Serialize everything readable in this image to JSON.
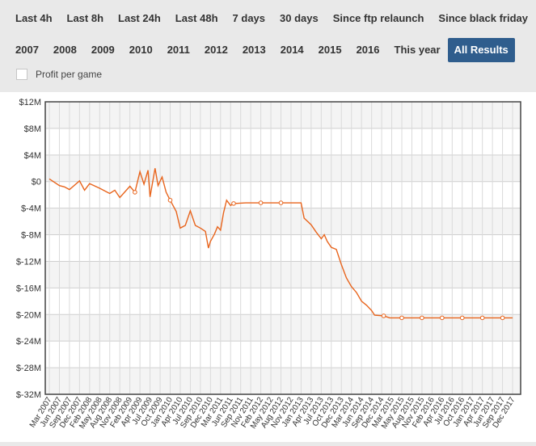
{
  "filters": {
    "row1": [
      "Last 4h",
      "Last 8h",
      "Last 24h",
      "Last 48h",
      "7 days",
      "30 days",
      "Since ftp relaunch",
      "Since black friday"
    ],
    "row2": [
      "2007",
      "2008",
      "2009",
      "2010",
      "2011",
      "2012",
      "2013",
      "2014",
      "2015",
      "2016",
      "This year",
      "All Results"
    ],
    "active": "All Results"
  },
  "checkbox": {
    "label": "Profit per game",
    "checked": false
  },
  "chart_data": {
    "type": "line",
    "title": "",
    "xlabel": "",
    "ylabel": "",
    "ylim": [
      -32,
      12
    ],
    "y_ticks": [
      12,
      8,
      4,
      0,
      -4,
      -8,
      -12,
      -16,
      -20,
      -24,
      -28,
      -32
    ],
    "y_tick_labels": [
      "$12M",
      "$8M",
      "$4M",
      "$0",
      "$-4M",
      "$-8M",
      "$-12M",
      "$-16M",
      "$-20M",
      "$-24M",
      "$-28M",
      "$-32M"
    ],
    "x_tick_labels": [
      "Mar 2007",
      "Jun 2007",
      "Sep 2007",
      "Dec 2007",
      "Feb 2008",
      "May 2008",
      "Aug 2008",
      "Nov 2008",
      "Feb 2009",
      "Apr 2009",
      "Jul 2009",
      "Oct 2009",
      "Jan 2010",
      "Apr 2010",
      "Jul 2010",
      "Sep 2010",
      "Dec 2010",
      "Mar 2011",
      "Jun 2011",
      "Sep 2011",
      "Nov 2011",
      "Feb 2012",
      "May 2012",
      "Aug 2012",
      "Nov 2012",
      "Jan 2013",
      "Apr 2013",
      "Jul 2013",
      "Oct 2013",
      "Dec 2013",
      "Mar 2014",
      "Jun 2014",
      "Sep 2014",
      "Dec 2014",
      "Mar 2015",
      "May 2015",
      "Aug 2015",
      "Nov 2015",
      "Feb 2016",
      "Apr 2016",
      "Jul 2016",
      "Oct 2016",
      "Jan 2017",
      "Apr 2017",
      "Jun 2017",
      "Sep 2017",
      "Dec 2017"
    ],
    "grid": true,
    "line_color": "#e8641c",
    "series": [
      {
        "values": [
          [
            0,
            0.4
          ],
          [
            1,
            -0.6
          ],
          [
            1.5,
            -0.8
          ],
          [
            2,
            -1.2
          ],
          [
            3,
            0.1
          ],
          [
            3.5,
            -1.3
          ],
          [
            4,
            -0.3
          ],
          [
            5,
            -1.0
          ],
          [
            6,
            -1.8
          ],
          [
            6.5,
            -1.3
          ],
          [
            7,
            -2.4
          ],
          [
            8,
            -0.7
          ],
          [
            8.5,
            -1.6
          ],
          [
            9,
            1.5
          ],
          [
            9.4,
            -0.4
          ],
          [
            9.8,
            1.7
          ],
          [
            10,
            -2.3
          ],
          [
            10.5,
            2.0
          ],
          [
            10.8,
            -0.6
          ],
          [
            11.2,
            0.7
          ],
          [
            11.6,
            -1.6
          ],
          [
            12,
            -2.8
          ],
          [
            12.6,
            -4.5
          ],
          [
            13,
            -7.0
          ],
          [
            13.5,
            -6.6
          ],
          [
            14,
            -4.4
          ],
          [
            14.5,
            -6.6
          ],
          [
            15,
            -7.0
          ],
          [
            15.5,
            -7.5
          ],
          [
            15.8,
            -10.0
          ],
          [
            16,
            -9.0
          ],
          [
            16.4,
            -7.9
          ],
          [
            16.7,
            -6.8
          ],
          [
            17,
            -7.3
          ],
          [
            17.3,
            -4.7
          ],
          [
            17.6,
            -2.8
          ],
          [
            18,
            -3.6
          ],
          [
            18.3,
            -3.3
          ],
          [
            19.5,
            -3.2
          ],
          [
            21,
            -3.2
          ],
          [
            23,
            -3.2
          ],
          [
            24.5,
            -3.2
          ],
          [
            25,
            -3.2
          ],
          [
            25.3,
            -5.5
          ],
          [
            26,
            -6.5
          ],
          [
            26.5,
            -7.6
          ],
          [
            27,
            -8.6
          ],
          [
            27.3,
            -8.0
          ],
          [
            27.6,
            -9.0
          ],
          [
            28,
            -9.9
          ],
          [
            28.5,
            -10.2
          ],
          [
            29,
            -12.5
          ],
          [
            29.5,
            -14.5
          ],
          [
            30,
            -15.8
          ],
          [
            30.5,
            -16.7
          ],
          [
            31,
            -18.0
          ],
          [
            31.5,
            -18.6
          ],
          [
            32,
            -19.4
          ],
          [
            32.3,
            -20.1
          ],
          [
            33.2,
            -20.2
          ],
          [
            33.8,
            -20.5
          ],
          [
            35,
            -20.5
          ],
          [
            37,
            -20.5
          ],
          [
            39,
            -20.5
          ],
          [
            41,
            -20.5
          ],
          [
            43,
            -20.5
          ],
          [
            45,
            -20.5
          ],
          [
            46,
            -20.5
          ]
        ],
        "markers_at": [
          8.5,
          12,
          18.3,
          21,
          23,
          33.2,
          35,
          37,
          39,
          41,
          43,
          45
        ]
      }
    ]
  }
}
